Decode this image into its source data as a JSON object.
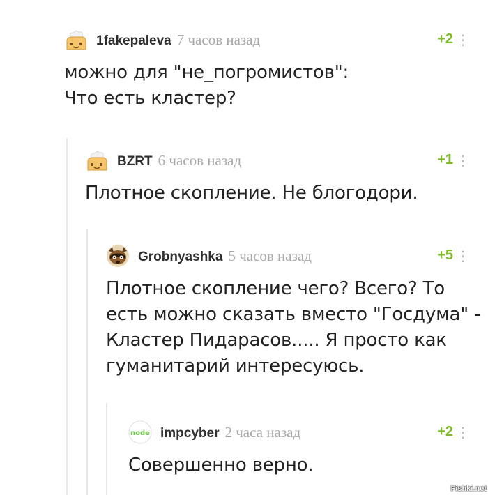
{
  "comments": [
    {
      "author": "1fakepaleva",
      "time": "7 часов назад",
      "rating": "+2",
      "menu": "⋮",
      "avatar_icon": "bread-chef-icon",
      "lines": [
        "можно для \"не_погромистов\":",
        "Что есть кластер?"
      ]
    },
    {
      "author": "BZRT",
      "time": "6 часов назад",
      "rating": "+1",
      "menu": "⋮",
      "avatar_icon": "bread-chef-icon",
      "lines": [
        "Плотное скопление. Не блогодори."
      ]
    },
    {
      "author": "Grobnyashka",
      "time": "5 часов назад",
      "rating": "+5",
      "menu": "⋮",
      "avatar_icon": "raccoon-icon",
      "lines": [
        "Плотное скопление чего? Всего? То",
        "есть можно сказать вместо \"Госдума\" -",
        "Кластер Пидарасов..... Я просто как",
        "гуманитарий интересуюсь."
      ]
    },
    {
      "author": "impcyber",
      "time": "2 часа назад",
      "rating": "+2",
      "menu": "⋮",
      "avatar_icon": "nodejs-icon",
      "avatar_text": "node",
      "lines": [
        "Совершенно верно."
      ]
    }
  ],
  "watermark": "Fishki.net",
  "colors": {
    "rating": "#7fba2a",
    "time": "#a8a8a8",
    "thread_line": "#e8e8e8"
  }
}
